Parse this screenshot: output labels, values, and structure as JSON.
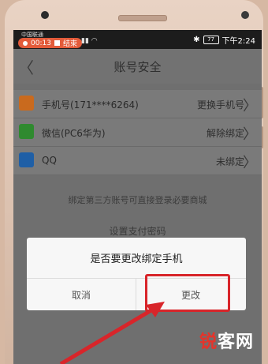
{
  "status_bar": {
    "carrier": "中国联通",
    "recording_time": "00:13",
    "stop_label": "结束",
    "battery": "77",
    "time": "下午2:24"
  },
  "nav": {
    "title": "账号安全",
    "back_icon": "chevron-left-icon"
  },
  "accounts": [
    {
      "icon": "phone-icon",
      "label": "手机号(171****6264)",
      "value": "更换手机号"
    },
    {
      "icon": "wechat-icon",
      "label": "微信(PC6华为)",
      "value": "解除绑定"
    },
    {
      "icon": "qq-icon",
      "label": "QQ",
      "value": "未绑定"
    }
  ],
  "hint": "绑定第三方账号可直接登录必要商城",
  "pay_password": "设置支付密码",
  "dialog": {
    "title": "是否要更改绑定手机",
    "cancel": "取消",
    "confirm": "更改"
  },
  "watermark": {
    "part1": "锐",
    "part2": "客网"
  },
  "colors": {
    "highlight": "#d8252a",
    "rec_pill": "#e35b3a"
  }
}
